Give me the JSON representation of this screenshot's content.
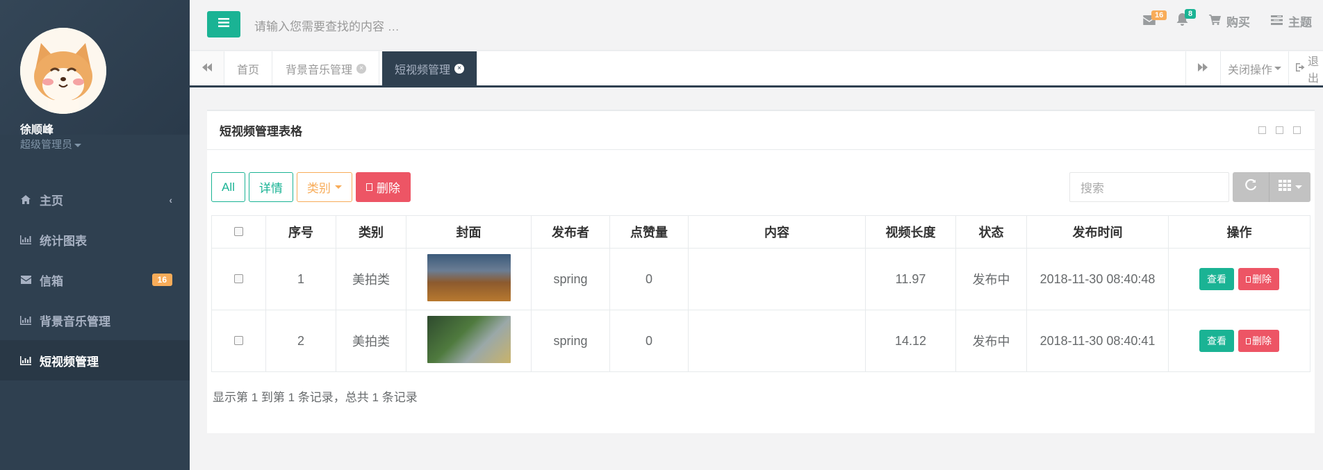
{
  "sidebar": {
    "user_name": "徐顺峰",
    "user_role": "超级管理员",
    "items": [
      {
        "label": "主页"
      },
      {
        "label": "统计图表"
      },
      {
        "label": "信箱",
        "badge": "16"
      },
      {
        "label": "背景音乐管理"
      },
      {
        "label": "短视频管理"
      }
    ]
  },
  "topbar": {
    "search_placeholder": "请输入您需要查找的内容 …",
    "mail_badge": "16",
    "bell_badge": "8",
    "buy_label": "购买",
    "theme_label": "主题"
  },
  "tabs": {
    "items": [
      {
        "label": "首页"
      },
      {
        "label": "背景音乐管理"
      },
      {
        "label": "短视频管理"
      }
    ],
    "close_ops": "关闭操作",
    "logout": "退出"
  },
  "panel": {
    "title": "短视频管理表格",
    "btn_all": "All",
    "btn_detail": "详情",
    "btn_category": "类别",
    "btn_delete": "删除",
    "search_placeholder": "搜索",
    "columns": [
      "序号",
      "类别",
      "封面",
      "发布者",
      "点赞量",
      "内容",
      "视频长度",
      "状态",
      "发布时间",
      "操作"
    ],
    "rows": [
      {
        "id": "1",
        "category": "美拍类",
        "publisher": "spring",
        "likes": "0",
        "content": "",
        "length": "11.97",
        "status": "发布中",
        "time": "2018-11-30 08:40:48"
      },
      {
        "id": "2",
        "category": "美拍类",
        "publisher": "spring",
        "likes": "0",
        "content": "",
        "length": "14.12",
        "status": "发布中",
        "time": "2018-11-30 08:40:41"
      }
    ],
    "op_view": "查看",
    "op_delete": "删除",
    "footer": "显示第 1 到第 1 条记录，总共 1 条记录"
  },
  "colors": {
    "accent": "#1ab394",
    "danger": "#ed5565",
    "warning": "#f8ac59",
    "sidebar": "#2f4050"
  }
}
